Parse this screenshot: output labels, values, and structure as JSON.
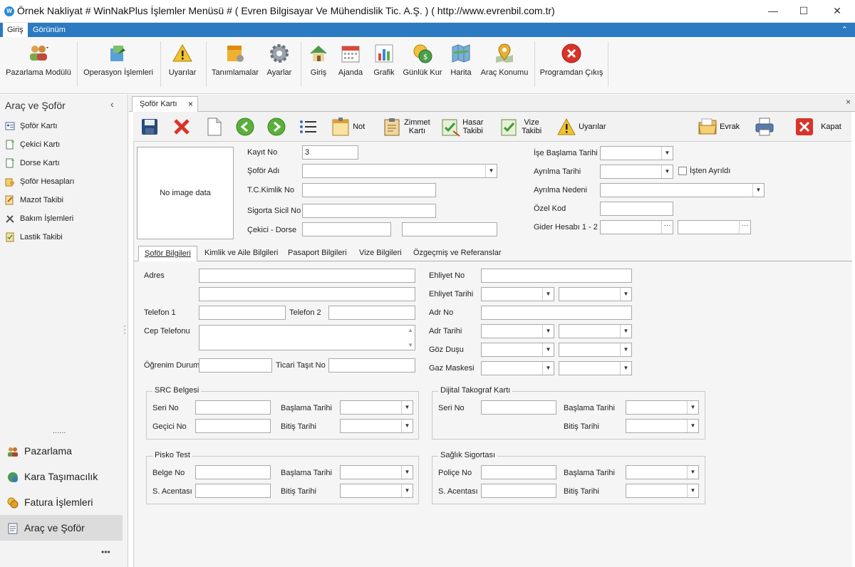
{
  "window": {
    "title": "Örnek Nakliyat # WinNakPlus İşlemler Menüsü #  ( Evren Bilgisayar Ve Mühendislik Tic. A.Ş. ) ( http://www.evrenbil.com.tr)",
    "minimize": "—",
    "maximize": "☐",
    "close": "✕"
  },
  "ribbon_tabs": [
    "Giriş",
    "Görünüm"
  ],
  "ribbon_collapse": "⌃",
  "ribbon": {
    "pazarlama": "Pazarlama Modülü",
    "operasyon": "Operasyon İşlemleri",
    "uyarilar": "Uyarılar",
    "tanimlamalar": "Tanımlamalar",
    "ayarlar": "Ayarlar",
    "giris": "Giriş",
    "ajanda": "Ajanda",
    "grafik": "Grafik",
    "gunluk_kur": "Günlük Kur",
    "harita": "Harita",
    "arac_konumu": "Araç Konumu",
    "cikis": "Programdan Çıkış"
  },
  "leftnav": {
    "title": "Araç ve Şoför",
    "collapse": "‹",
    "items": [
      "Şoför Kartı",
      "Çekici Kartı",
      "Dorse Kartı",
      "Şoför Hesapları",
      "Mazot Takibi",
      "Bakım İşlemleri",
      "Lastik Takibi"
    ],
    "dots": "......",
    "groups": [
      "Pazarlama",
      "Kara Taşımacılık",
      "Fatura İşlemleri",
      "Araç ve Şoför"
    ],
    "more": "•••"
  },
  "doc_tab": {
    "label": "Şoför Kartı",
    "close": "×",
    "close_all": "×"
  },
  "toolbar": {
    "not": "Not",
    "zimmet_1": "Zimmet",
    "zimmet_2": "Kartı",
    "hasar_1": "Hasar",
    "hasar_2": "Takibi",
    "vize_1": "Vize",
    "vize_2": "Takibi",
    "uyarilar": "Uyarılar",
    "evrak": "Evrak",
    "kapat": "Kapat"
  },
  "form": {
    "photo": "No image data",
    "kayit_no_label": "Kayıt No",
    "kayit_no_value": "3",
    "sofor_adi_label": "Şoför Adı",
    "tc_label": "T.C.Kimlik No",
    "sigorta_label": "Sigorta Sicil No",
    "cekici_label": "Çekici - Dorse",
    "ise_baslama_label": "İşe Başlama Tarihi",
    "ayrilma_tarihi_label": "Ayrılma Tarihi",
    "isten_ayrildi_label": "İşten Ayrıldı",
    "ayrilma_nedeni_label": "Ayrılma Nedeni",
    "ozel_kod_label": "Özel Kod",
    "gider_label": "Gider Hesabı 1 - 2"
  },
  "inner_tabs": [
    "Şoför Bilgileri",
    "Kimlik ve Aile Bilgileri",
    "Pasaport Bilgileri",
    "Vize Bilgileri",
    "Özgeçmiş ve Referanslar"
  ],
  "detail": {
    "adres": "Adres",
    "telefon1": "Telefon 1",
    "telefon2": "Telefon 2",
    "cep": "Cep Telefonu",
    "ogrenim": "Öğrenim Durum",
    "ticari": "Ticari Taşıt No",
    "ehliyet_no": "Ehliyet No",
    "ehliyet_tarihi": "Ehliyet Tarihi",
    "adr_no": "Adr No",
    "adr_tarihi": "Adr Tarihi",
    "goz": "Göz Duşu",
    "gaz": "Gaz Maskesi"
  },
  "groups": {
    "src": {
      "title": "SRC Belgesi",
      "seri": "Seri No",
      "gecici": "Geçici  No",
      "baslama": "Başlama Tarihi",
      "bitis": "Bitiş Tarihi"
    },
    "takograf": {
      "title": "Dijital Takograf Kartı",
      "seri": "Seri No",
      "baslama": "Başlama Tarihi",
      "bitis": "Bitiş Tarihi"
    },
    "pisko": {
      "title": "Pisko Test",
      "belge": "Belge No",
      "acente": "S. Acentası",
      "baslama": "Başlama Tarihi",
      "bitis": "Bitiş Tarihi"
    },
    "saglik": {
      "title": "Sağlık Sigortası",
      "police": "Poliçe No",
      "acente": "S. Acentası",
      "baslama": "Başlama Tarihi",
      "bitis": "Bitiş Tarihi"
    }
  }
}
